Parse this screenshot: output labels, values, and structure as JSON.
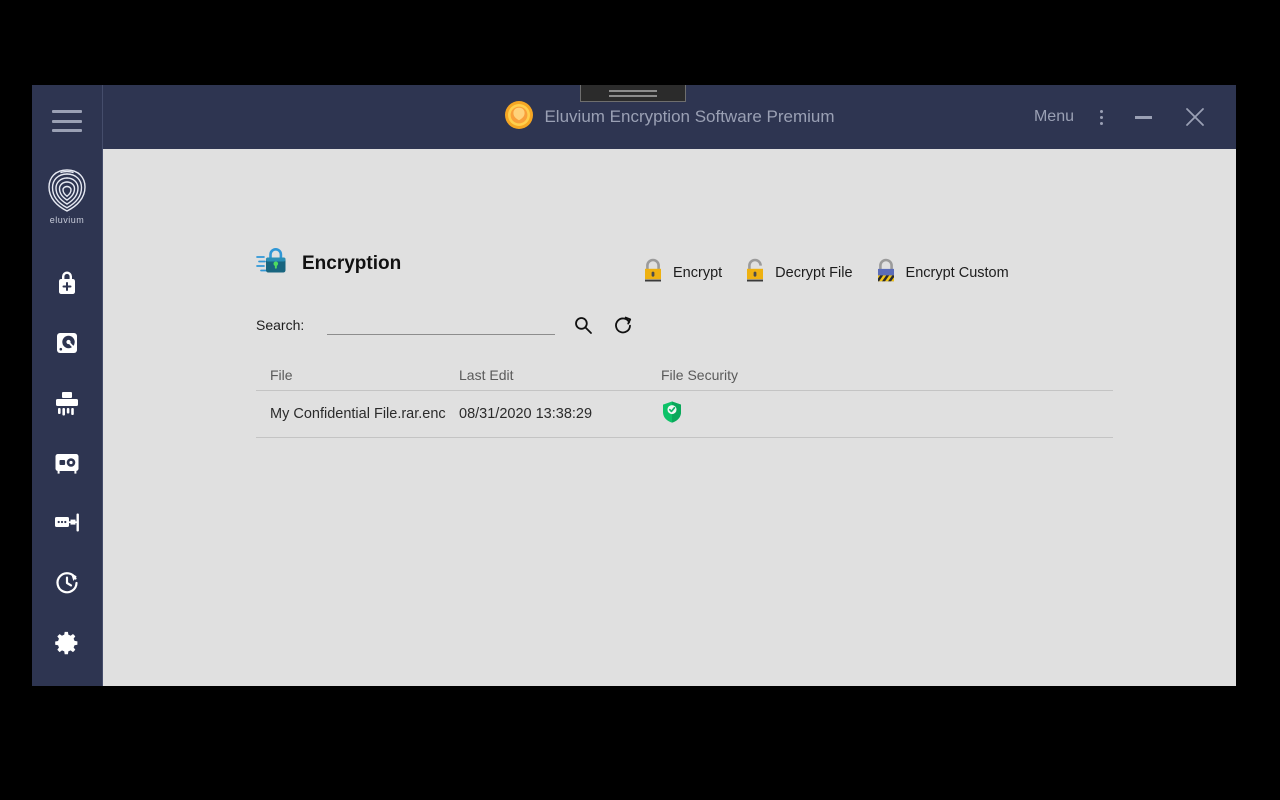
{
  "window": {
    "titlebar": {
      "app_icon": "eluvium-coin-icon",
      "title": "Eluvium Encryption Software Premium",
      "menu_label": "Menu",
      "kebab_icon": "more-vertical-icon",
      "minimize_icon": "minimize-icon",
      "close_icon": "close-icon"
    },
    "drag_handle": "window-drag-handle"
  },
  "sidebar": {
    "hamburger_icon": "hamburger-menu-icon",
    "brand": {
      "logo_icon": "fingerprint-logo-icon",
      "name": "eluvium"
    },
    "items": [
      {
        "name": "sidebar-item-encrypt",
        "icon": "lock-plus-icon"
      },
      {
        "name": "sidebar-item-disk",
        "icon": "hard-disk-icon"
      },
      {
        "name": "sidebar-item-shredder",
        "icon": "shredder-icon"
      },
      {
        "name": "sidebar-item-safe",
        "icon": "safe-vault-icon"
      },
      {
        "name": "sidebar-item-password-manager",
        "icon": "password-card-icon"
      },
      {
        "name": "sidebar-item-history",
        "icon": "clock-restore-icon"
      },
      {
        "name": "sidebar-item-settings",
        "icon": "gear-icon"
      }
    ]
  },
  "page": {
    "icon": "encryption-lock-icon",
    "title": "Encryption",
    "toolbar": [
      {
        "label": "Encrypt",
        "icon": "padlock-closed-icon"
      },
      {
        "label": "Decrypt File",
        "icon": "padlock-open-icon"
      },
      {
        "label": "Encrypt Custom",
        "icon": "padlock-striped-icon"
      }
    ],
    "search": {
      "label": "Search:",
      "value": "",
      "placeholder": "",
      "search_icon": "search-icon",
      "refresh_icon": "refresh-icon"
    },
    "table": {
      "columns": [
        "File",
        "Last Edit",
        "File Security"
      ],
      "rows": [
        {
          "file": "My Confidential File.rar.enc",
          "last_edit": "08/31/2020 13:38:29",
          "security_icon": "green-shield-check-icon"
        }
      ]
    }
  },
  "colors": {
    "sidebar_bg": "#2e3551",
    "titlebar_bg": "#2e3551",
    "content_bg": "#e0e0e0",
    "title_text": "#9aa0b4",
    "accent_yellow": "#f0b323",
    "accent_green": "#0ec268",
    "accent_blue": "#1a7ea8"
  }
}
